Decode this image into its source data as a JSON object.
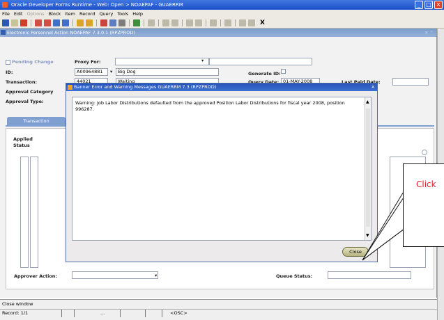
{
  "window": {
    "title": "Oracle Developer Forms Runtime - Web: Open > NOAEPAF - GUAERRM"
  },
  "menubar": [
    "File",
    "Edit",
    "Options",
    "Block",
    "Item",
    "Record",
    "Query",
    "Tools",
    "Help"
  ],
  "form": {
    "title": "Electronic Personnel Action  NOAEPAF  7.3.0.1  (RPZPROD)",
    "pending_change_label": "Pending Change",
    "proxy_for_label": "Proxy For:",
    "id_label": "ID:",
    "id_value": "A00964881",
    "id_name": "Big Dog",
    "generate_id_label": "Generate ID:",
    "transaction_label": "Transaction:",
    "transaction_value": "44021",
    "transaction_status": "Waiting",
    "query_date_label": "Query Date:",
    "query_date_value": "01-MAY-2008",
    "last_paid_date_label": "Last Paid Date:",
    "approval_category_label": "Approval Category",
    "approval_type_label": "Approval Type:",
    "tab_transaction": "Transaction",
    "applied_label": "Applied",
    "status_label": "Status",
    "approver_action_label": "Approver Action:",
    "queue_status_label": "Queue Status:"
  },
  "dialog": {
    "title": "Banner Error and Warning Messages  GUAERRM  7.3  (RPZPROD)",
    "message": "Warning: Job Labor Distributions defaulted from the approved Position Labor Distributions for fiscal year 2008, position 996287.",
    "close_label": "Close"
  },
  "status_bar": {
    "message": "Close window",
    "record": "Record: 1/1",
    "osc": "<OSC>"
  },
  "callout": {
    "text": "Click"
  }
}
